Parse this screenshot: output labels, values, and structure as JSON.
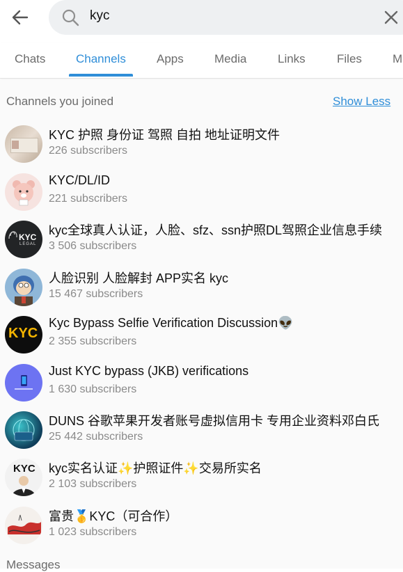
{
  "search": {
    "query": "kyc"
  },
  "tabs": [
    {
      "label": "Chats"
    },
    {
      "label": "Channels"
    },
    {
      "label": "Apps"
    },
    {
      "label": "Media"
    },
    {
      "label": "Links"
    },
    {
      "label": "Files"
    },
    {
      "label": "M"
    }
  ],
  "section": {
    "title": "Channels you joined",
    "toggle_label": "Show Less"
  },
  "channels": [
    {
      "title": "KYC 护照 身份证 驾照 自拍 地址证明文件",
      "subscribers": "226 subscribers"
    },
    {
      "title": "KYC/DL/ID",
      "subscribers": "221 subscribers"
    },
    {
      "title": "kyc全球真人认证，人脸、sfz、ssn护照DL驾照企业信息手续",
      "subscribers": "3 506 subscribers",
      "avatar_text": "KYC",
      "avatar_subtext": "LEGAL"
    },
    {
      "title": "人脸识别 人脸解封 APP实名 kyc",
      "subscribers": "15 467 subscribers"
    },
    {
      "title": "Kyc Bypass Selfie Verification Discussion👽",
      "subscribers": "2 355 subscribers",
      "avatar_text": "KYC"
    },
    {
      "title": "Just KYC bypass (JKB) verifications",
      "subscribers": "1 630 subscribers"
    },
    {
      "title": "DUNS 谷歌苹果开发者账号虚拟信用卡 专用企业资料邓白氏",
      "subscribers": "25 442 subscribers"
    },
    {
      "title": "kyc实名认证✨护照证件✨交易所实名",
      "subscribers": "2 103 subscribers",
      "avatar_text": "KYC"
    },
    {
      "title": "富贵🥇KYC（可合作）",
      "subscribers": "1 023 subscribers"
    }
  ],
  "messages_section": {
    "title": "Messages"
  },
  "colors": {
    "accent": "#2f8ed8",
    "secondary_text": "#8a8a8a",
    "search_bg": "#eef0f2"
  }
}
